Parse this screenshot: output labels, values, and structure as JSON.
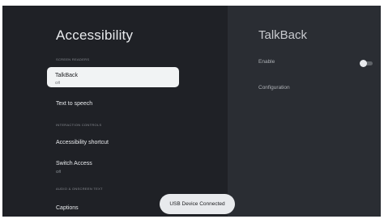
{
  "left": {
    "title": "Accessibility",
    "sections": [
      {
        "header": "SCREEN READERS"
      },
      {
        "header": "INTERACTION CONTROLS"
      },
      {
        "header": "AUDIO & ONSCREEN TEXT"
      }
    ],
    "items": [
      {
        "label": "TalkBack",
        "sub": "Off",
        "selected": true
      },
      {
        "label": "Text to speech"
      },
      {
        "label": "Accessibility shortcut"
      },
      {
        "label": "Switch Access",
        "sub": "Off"
      },
      {
        "label": "Captions"
      }
    ]
  },
  "right": {
    "title": "TalkBack",
    "enable_label": "Enable",
    "enable_state": false,
    "config_label": "Configuration"
  },
  "toast": {
    "text": "USB Device Connected"
  }
}
